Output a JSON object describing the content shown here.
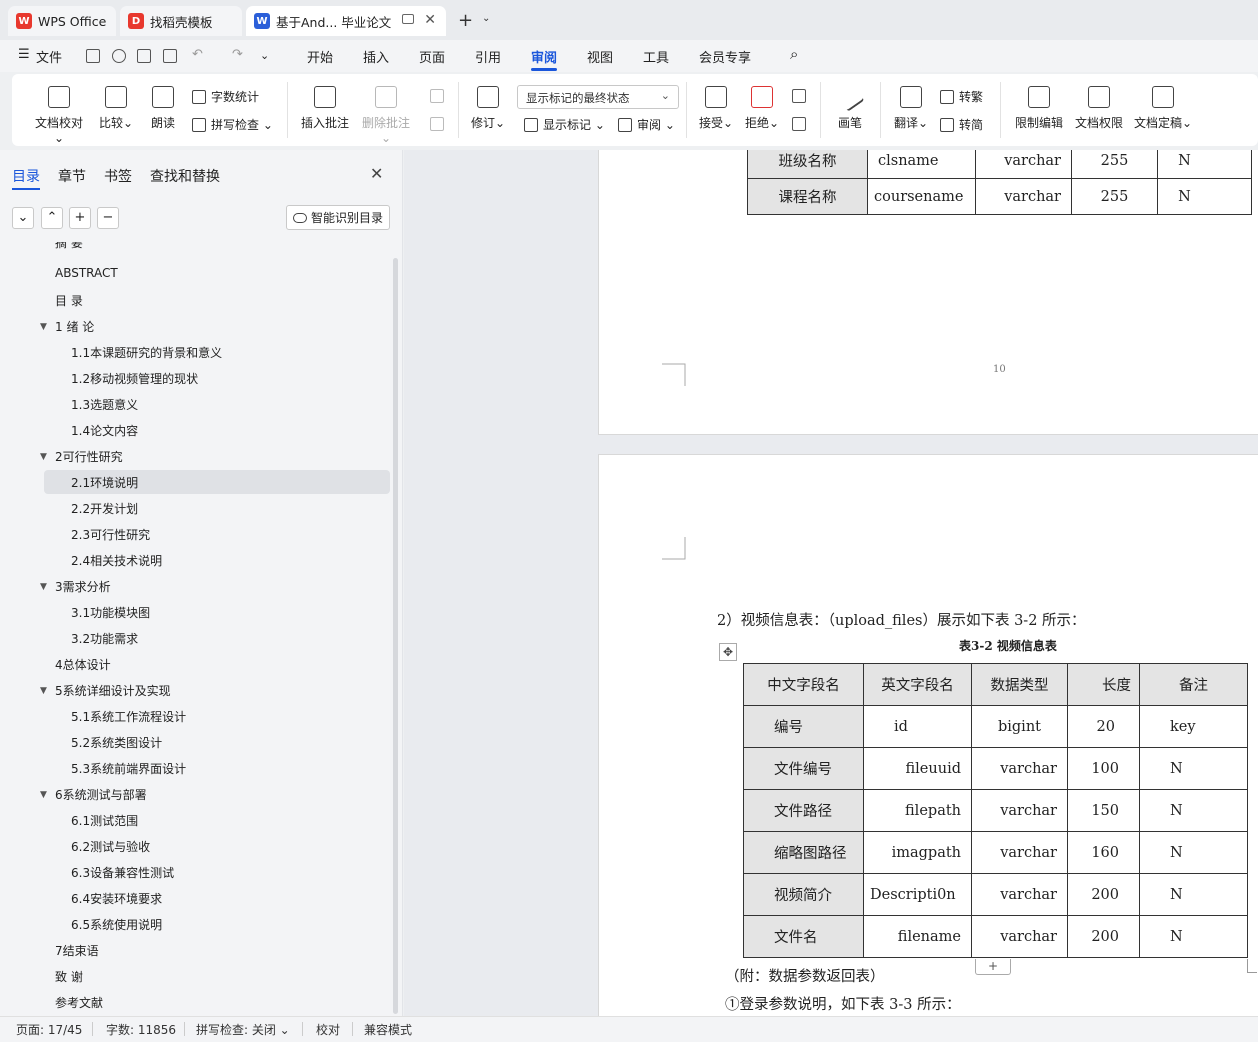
{
  "titlebar": {
    "tabs": [
      {
        "label": "WPS Office"
      },
      {
        "label": "找稻壳模板"
      },
      {
        "label": "基于And... 毕业论文"
      }
    ],
    "new_tab": "+"
  },
  "menu": {
    "file": "文件",
    "items": [
      "开始",
      "插入",
      "页面",
      "引用",
      "审阅",
      "视图",
      "工具",
      "会员专享"
    ],
    "active": "审阅"
  },
  "ribbon": {
    "doc_proofread": "文档校对",
    "compare": "比较",
    "read_aloud": "朗读",
    "word_count": "字数统计",
    "spell_check": "拼写检查",
    "insert_comment": "插入批注",
    "delete_comment": "删除批注",
    "track_changes": "修订",
    "markup_state": "显示标记的最终状态",
    "show_markup": "显示标记",
    "review": "审阅",
    "accept": "接受",
    "reject": "拒绝",
    "pen": "画笔",
    "translate": "翻译",
    "to_traditional": "转繁",
    "to_simplified": "转简",
    "restrict_edit": "限制编辑",
    "doc_permission": "文档权限",
    "doc_finalize": "文档定稿"
  },
  "nav": {
    "tabs": [
      "目录",
      "章节",
      "书签",
      "查找和替换"
    ],
    "active_tab": "目录",
    "smart_button": "智能识别目录",
    "toc": [
      {
        "label": "摘 要"
      },
      {
        "label": "ABSTRACT"
      },
      {
        "label": "目 录"
      },
      {
        "label": "1 绪 论"
      },
      {
        "label": "1.1本课题研究的背景和意义"
      },
      {
        "label": "1.2移动视频管理的现状"
      },
      {
        "label": "1.3选题意义"
      },
      {
        "label": "1.4论文内容"
      },
      {
        "label": "2可行性研究"
      },
      {
        "label": "2.1环境说明"
      },
      {
        "label": "2.2开发计划"
      },
      {
        "label": "2.3可行性研究"
      },
      {
        "label": "2.4相关技术说明"
      },
      {
        "label": "3需求分析"
      },
      {
        "label": "3.1功能模块图"
      },
      {
        "label": "3.2功能需求"
      },
      {
        "label": "4总体设计"
      },
      {
        "label": "5系统详细设计及实现"
      },
      {
        "label": "5.1系统工作流程设计"
      },
      {
        "label": "5.2系统类图设计"
      },
      {
        "label": "5.3系统前端界面设计"
      },
      {
        "label": "6系统测试与部署"
      },
      {
        "label": "6.1测试范围"
      },
      {
        "label": "6.2测试与验收"
      },
      {
        "label": "6.3设备兼容性测试"
      },
      {
        "label": "6.4安装环境要求"
      },
      {
        "label": "6.5系统使用说明"
      },
      {
        "label": "7结束语"
      },
      {
        "label": "致 谢"
      },
      {
        "label": "参考文献"
      }
    ],
    "selected": "2.1环境说明"
  },
  "document": {
    "table1_rows": [
      [
        "班级名称",
        "clsname",
        "varchar",
        "255",
        "N"
      ],
      [
        "课程名称",
        "coursename",
        "varchar",
        "255",
        "N"
      ]
    ],
    "page_number": "10",
    "paragraph1": "2）视频信息表：（upload_files）展示如下表 3-2 所示：",
    "table2_caption": "表3-2  视频信息表",
    "table2_header": [
      "中文字段名",
      "英文字段名",
      "数据类型",
      "长度",
      "备注"
    ],
    "table2_rows": [
      [
        "编号",
        "id",
        "bigint",
        "20",
        "key"
      ],
      [
        "文件编号",
        "fileuuid",
        "varchar",
        "100",
        "N"
      ],
      [
        "文件路径",
        "filepath",
        "varchar",
        "150",
        "N"
      ],
      [
        "缩略图路径",
        "imagpath",
        "varchar",
        "160",
        "N"
      ],
      [
        "视频简介",
        "Descripti0n",
        "varchar",
        "200",
        "N"
      ],
      [
        "文件名",
        "filename",
        "varchar",
        "200",
        "N"
      ]
    ],
    "paragraph2": "（附：数据参数返回表）",
    "paragraph3": "①登录参数说明，如下表 3-3 所示："
  },
  "status": {
    "page": "页面: 17/45",
    "words": "字数: 11856",
    "spell": "拼写检查: 关闭",
    "proof": "校对",
    "compat": "兼容模式"
  },
  "colors": {
    "accent": "#1a56db",
    "wps_red": "#e8382e",
    "writer_blue": "#2b5fd9"
  }
}
